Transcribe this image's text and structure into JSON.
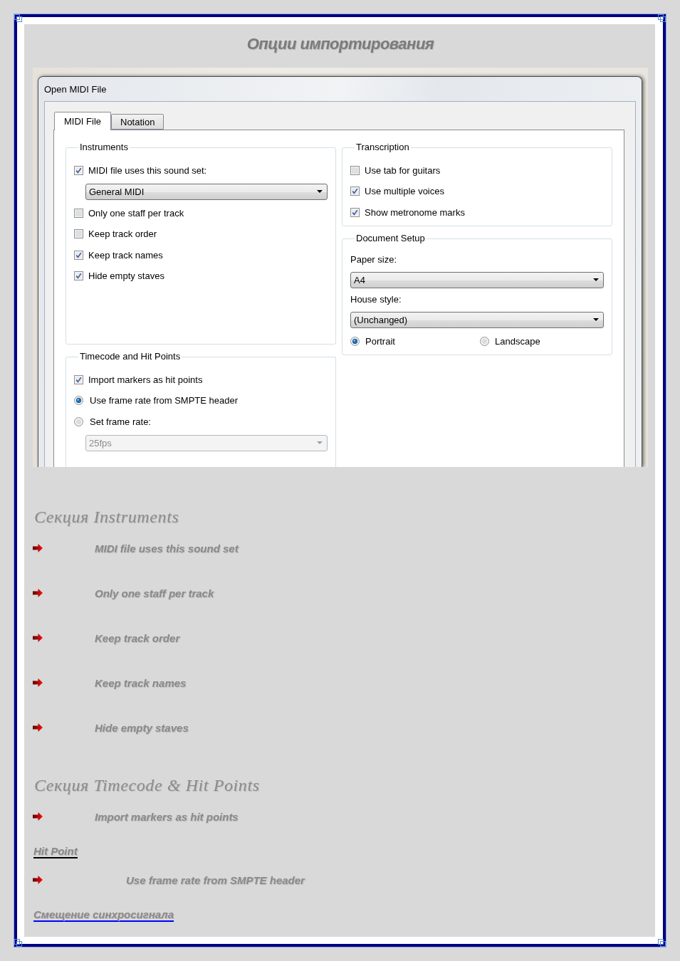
{
  "page": {
    "title": "Опции импортирования"
  },
  "dialog": {
    "title": "Open MIDI File",
    "tabs": [
      {
        "label": "MIDI File",
        "selected": true
      },
      {
        "label": "Notation",
        "selected": false
      }
    ],
    "columns": [
      {
        "groups": [
          {
            "title": "Instruments",
            "items": [
              {
                "kind": "checkbox",
                "label": "MIDI file uses this sound set:",
                "checked": true
              },
              {
                "kind": "dropdown",
                "value": "General MIDI",
                "disabled": false
              },
              {
                "kind": "checkbox",
                "label": "Only one staff per track",
                "checked": false
              },
              {
                "kind": "checkbox",
                "label": "Keep track order",
                "checked": false
              },
              {
                "kind": "checkbox",
                "label": "Keep track names",
                "checked": true
              },
              {
                "kind": "checkbox",
                "label": "Hide empty staves",
                "checked": true
              }
            ]
          },
          {
            "title": "Timecode and Hit Points",
            "items": [
              {
                "kind": "checkbox",
                "label": "Import markers as hit points",
                "checked": true
              },
              {
                "kind": "radio",
                "label": "Use frame rate from SMPTE header",
                "selected": true
              },
              {
                "kind": "radio",
                "label": "Set frame rate:",
                "selected": false
              },
              {
                "kind": "dropdown",
                "value": "25fps",
                "disabled": true
              }
            ]
          }
        ]
      },
      {
        "groups": [
          {
            "title": "Transcription",
            "items": [
              {
                "kind": "checkbox",
                "label": "Use tab for guitars",
                "checked": false
              },
              {
                "kind": "checkbox",
                "label": "Use multiple voices",
                "checked": true
              },
              {
                "kind": "checkbox",
                "label": "Show metronome marks",
                "checked": true
              }
            ]
          },
          {
            "title": "Document Setup",
            "items": [
              {
                "kind": "label",
                "text": "Paper size:"
              },
              {
                "kind": "dropdown",
                "value": "A4",
                "disabled": false
              },
              {
                "kind": "label",
                "text": "House style:"
              },
              {
                "kind": "dropdown",
                "value": "(Unchanged)",
                "disabled": false
              },
              {
                "kind": "radio_row",
                "options": [
                  {
                    "label": "Portrait",
                    "selected": true
                  },
                  {
                    "label": "Landscape",
                    "selected": false
                  }
                ]
              }
            ]
          }
        ]
      }
    ]
  },
  "notes": [
    {
      "heading": "Секция Instruments",
      "items": [
        {
          "kind": "bullet",
          "text": "MIDI file uses this sound set"
        },
        {
          "kind": "bullet",
          "text": "Only one staff per track"
        },
        {
          "kind": "bullet",
          "text": "Keep track order"
        },
        {
          "kind": "bullet",
          "text": "Keep track names"
        },
        {
          "kind": "bullet",
          "text": "Hide empty staves"
        }
      ]
    },
    {
      "heading": "Секция Timecode & Hit Points",
      "items": [
        {
          "kind": "bullet",
          "text": "Import markers as hit points"
        },
        {
          "kind": "link",
          "text": "Hit Point",
          "color": "#000000"
        },
        {
          "kind": "bullet",
          "text": "Use frame rate from SMPTE header"
        },
        {
          "kind": "link",
          "text": "Смещение синхросигнала",
          "color": "#0000ff"
        }
      ]
    }
  ]
}
